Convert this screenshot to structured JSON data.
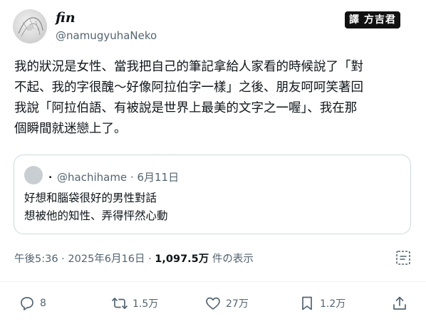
{
  "author": {
    "display_name": "fin",
    "handle": "@namugyuhaNeko"
  },
  "watermark": "譯 方吉君",
  "tweet": {
    "text": "我的狀況是女性、當我把自己的筆記拿給人家看的時候說了「對\n不起、我的字很醜〜好像阿拉伯字一樣」之後、朋友呵呵笑著回\n我說「阿拉伯語、有被說是世界上最美的文字之一喔」、我在那\n個瞬間就迷戀上了。"
  },
  "quote": {
    "dot": ".",
    "handle_date": "@hachihame · 6月11日",
    "text": "好想和腦袋很好的男性對話\n想被他的知性、弄得怦然心動"
  },
  "meta": {
    "timestamp": "午後5:36 · 2025年6月16日 · ",
    "views": "1,097.5万",
    "views_suffix": " 件の表示"
  },
  "actions": {
    "replies": "8",
    "retweets": "1.5万",
    "likes": "27万",
    "bookmarks": "1.2万"
  },
  "colors": {
    "text": "#0f1419",
    "secondary": "#536471",
    "border": "#cfd9de"
  }
}
